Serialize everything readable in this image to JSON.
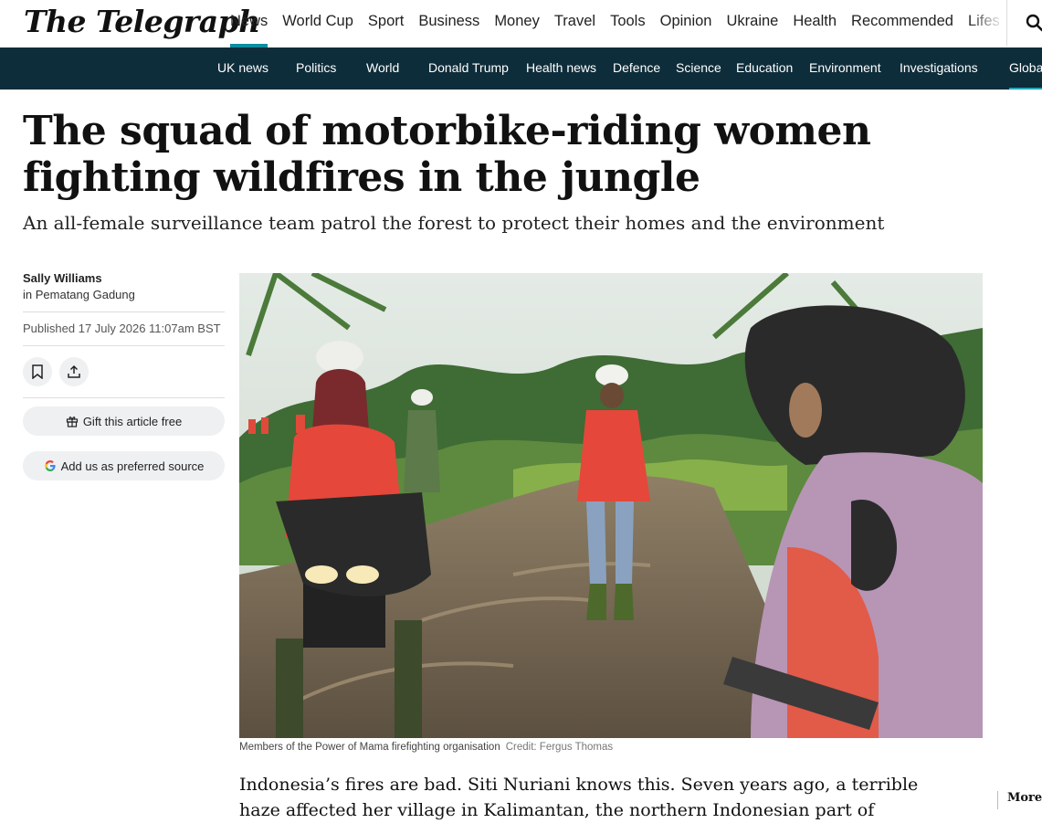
{
  "masthead": {
    "logo": "The Telegraph",
    "nav": [
      "News",
      "World Cup",
      "Sport",
      "Business",
      "Money",
      "Travel",
      "Tools",
      "Opinion",
      "Ukraine",
      "Health",
      "Recommended",
      "Lifes"
    ],
    "active_index": 0
  },
  "subnav": [
    "UK news",
    "Politics",
    "World",
    "Donald Trump",
    "Health news",
    "Defence",
    "Science",
    "Education",
    "Environment",
    "Investigations",
    "Globa"
  ],
  "article": {
    "headline": "The squad of motorbike-riding women fighting wildfires in the jungle",
    "standfirst": "An all-female surveillance team patrol the forest to protect their homes and the environment",
    "author": "Sally Williams",
    "location": "in Pematang Gadung",
    "published": "Published 17 July 2026 11:07am BST",
    "gift_label": "Gift this article free",
    "source_label": "Add us as preferred source",
    "caption": "Members of the Power of Mama firefighting organisation",
    "credit": "Credit: Fergus Thomas",
    "body": "Indonesia’s fires are bad. Siti Nuriani knows this. Seven years ago, a terrible haze affected her village in Kalimantan, the northern Indonesian part of",
    "more_label": "More"
  },
  "colors": {
    "accent": "#0a8ea0",
    "subnav_bg": "#0e2d3a"
  },
  "icons": [
    "search-icon",
    "bookmark-icon",
    "share-icon",
    "gift-icon",
    "google-icon"
  ]
}
